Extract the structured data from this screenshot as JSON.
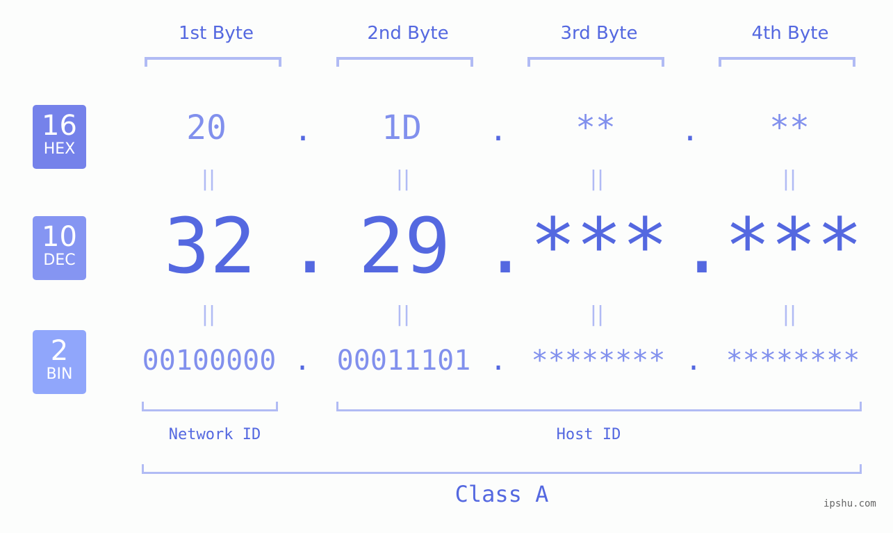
{
  "headers": [
    "1st Byte",
    "2nd Byte",
    "3rd Byte",
    "4th Byte"
  ],
  "badges": [
    {
      "num": "16",
      "label": "HEX",
      "color": "#7582ea"
    },
    {
      "num": "10",
      "label": "DEC",
      "color": "#8595f2"
    },
    {
      "num": "2",
      "label": "BIN",
      "color": "#90a6fb"
    }
  ],
  "hex": [
    "20",
    "1D",
    "**",
    "**"
  ],
  "dec": [
    "32",
    "29",
    "***",
    "***"
  ],
  "bin": [
    "00100000",
    "00011101",
    "********",
    "********"
  ],
  "separator": ".",
  "equals": "||",
  "network_label": "Network ID",
  "host_label": "Host ID",
  "class_label": "Class A",
  "watermark": "ipshu.com",
  "colors": {
    "accent": "#5468e0",
    "light": "#8190ed",
    "bracket": "#b1bbf4"
  }
}
